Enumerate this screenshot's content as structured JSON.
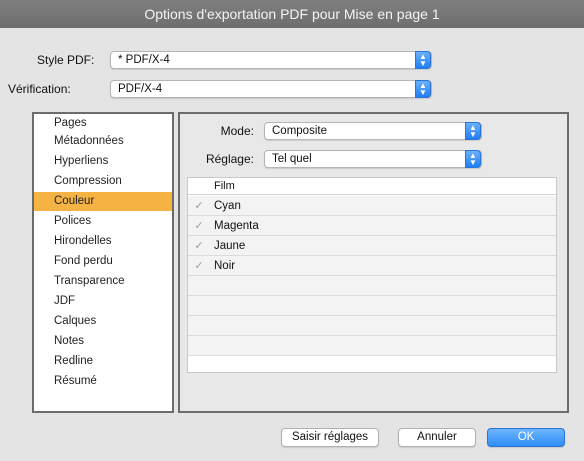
{
  "window": {
    "title": "Options d'exportation PDF pour Mise en page 1"
  },
  "top": {
    "style_label": "Style PDF:",
    "style_value": "* PDF/X-4",
    "verification_label": "Vérification:",
    "verification_value": "PDF/X-4"
  },
  "sidebar": {
    "items": [
      {
        "label": "Pages"
      },
      {
        "label": "Métadonnées"
      },
      {
        "label": "Hyperliens"
      },
      {
        "label": "Compression"
      },
      {
        "label": "Couleur"
      },
      {
        "label": "Polices"
      },
      {
        "label": "Hirondelles"
      },
      {
        "label": "Fond perdu"
      },
      {
        "label": "Transparence"
      },
      {
        "label": "JDF"
      },
      {
        "label": "Calques"
      },
      {
        "label": "Notes"
      },
      {
        "label": "Redline"
      },
      {
        "label": "Résumé"
      }
    ],
    "selected_label": "Couleur"
  },
  "color_panel": {
    "mode_label": "Mode:",
    "mode_value": "Composite",
    "setting_label": "Réglage:",
    "setting_value": "Tel quel",
    "table_header": "Film",
    "films": [
      {
        "name": "Cyan",
        "checked": true
      },
      {
        "name": "Magenta",
        "checked": true
      },
      {
        "name": "Jaune",
        "checked": true
      },
      {
        "name": "Noir",
        "checked": true
      }
    ]
  },
  "buttons": {
    "capture": "Saisir réglages",
    "cancel": "Annuler",
    "ok": "OK"
  },
  "colors": {
    "selection": "#f4b343",
    "accent_blue": "#2f8ef7",
    "titlebar": "#767676"
  },
  "icons": {
    "popup_arrows": "up-down-chevron-icon",
    "checkmark": "checkmark-icon"
  }
}
